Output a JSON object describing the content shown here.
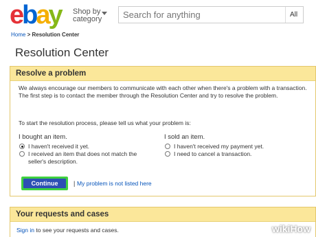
{
  "header": {
    "logo_letters": [
      {
        "ch": "e",
        "color": "#e53238"
      },
      {
        "ch": "b",
        "color": "#0064d2"
      },
      {
        "ch": "a",
        "color": "#f5af02"
      },
      {
        "ch": "y",
        "color": "#86b817"
      }
    ],
    "shop_line1": "Shop by",
    "shop_line2": "category",
    "search_placeholder": "Search for anything",
    "search_category": "All"
  },
  "breadcrumb": {
    "home": "Home",
    "separator": ">",
    "current": "Resolution Center"
  },
  "page_title": "Resolution Center",
  "resolve_panel": {
    "title": "Resolve a problem",
    "intro": "We always encourage our members to communicate with each other when there's a problem with a transaction. The first step is to contact the member through the Resolution Center and try to resolve the problem.",
    "prompt": "To start the resolution process, please tell us what your problem is:",
    "bought": {
      "title": "I bought an item.",
      "options": [
        {
          "label": "I haven't received it yet.",
          "selected": true
        },
        {
          "label": "I received an item that does not match the",
          "label2": "seller's description.",
          "selected": false
        }
      ]
    },
    "sold": {
      "title": "I sold an item.",
      "options": [
        {
          "label": "I haven't received my payment yet.",
          "selected": false
        },
        {
          "label": "I need to cancel a transaction.",
          "selected": false
        }
      ]
    },
    "continue_label": "Continue",
    "separator": "|",
    "not_listed_link": "My problem is not listed here"
  },
  "requests_panel": {
    "title": "Your requests and cases",
    "sign_in_link": "Sign in",
    "text": "to see your requests and cases."
  },
  "watermark": "wikiHow",
  "colors": {
    "panel_header": "#fbe79a",
    "link": "#0654ba",
    "continue_button": "#2d4fb4",
    "continue_highlight": "#3fd13f"
  }
}
